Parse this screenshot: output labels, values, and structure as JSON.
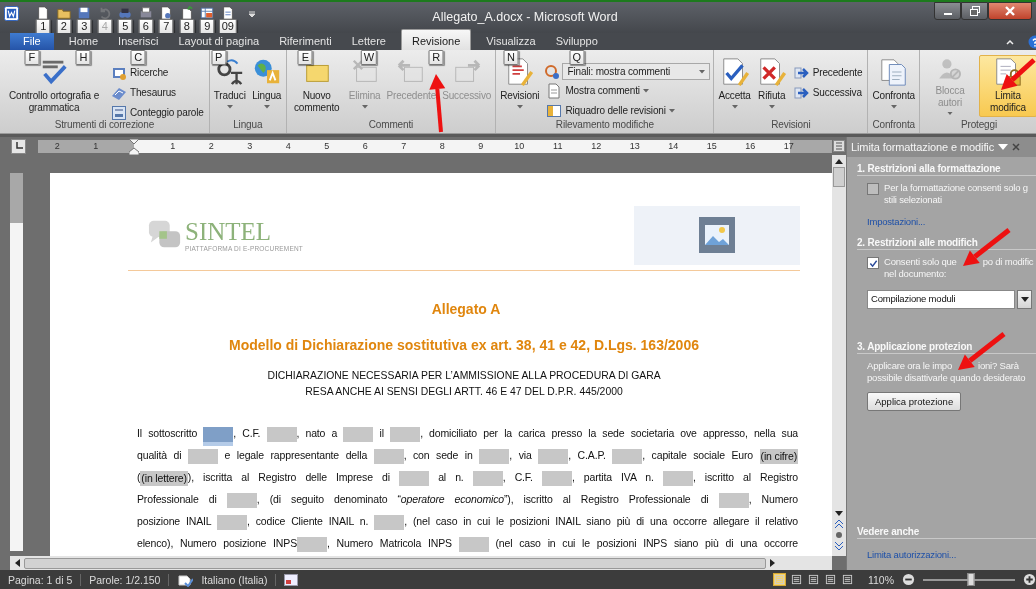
{
  "window": {
    "title": "Allegato_A.docx - Microsoft Word"
  },
  "quick_access": [
    {
      "key": "1",
      "disabled": false
    },
    {
      "key": "2",
      "disabled": false
    },
    {
      "key": "3",
      "disabled": false
    },
    {
      "key": "4",
      "disabled": true
    },
    {
      "key": "5",
      "disabled": false
    },
    {
      "key": "6",
      "disabled": false
    },
    {
      "key": "7",
      "disabled": false
    },
    {
      "key": "8",
      "disabled": false
    },
    {
      "key": "9",
      "disabled": false
    },
    {
      "key": "09",
      "disabled": false
    }
  ],
  "tabs": [
    {
      "label": "File",
      "key": "F",
      "kind": "file",
      "selected": false
    },
    {
      "label": "Home",
      "key": "H",
      "kind": "tab",
      "selected": false
    },
    {
      "label": "Inserisci",
      "key": "C",
      "kind": "tab",
      "selected": false
    },
    {
      "label": "Layout di pagina",
      "key": "P",
      "kind": "tab",
      "selected": false
    },
    {
      "label": "Riferimenti",
      "key": "E",
      "kind": "tab",
      "selected": false
    },
    {
      "label": "Lettere",
      "key": "W",
      "kind": "tab",
      "selected": false
    },
    {
      "label": "Revisione",
      "key": "R",
      "kind": "tab",
      "selected": true
    },
    {
      "label": "Visualizza",
      "key": "N",
      "kind": "tab",
      "selected": false
    },
    {
      "label": "Sviluppo",
      "key": "Q",
      "kind": "tab",
      "selected": false
    }
  ],
  "ribbon": {
    "groups": [
      {
        "label": "Strumenti di correzione",
        "items": [
          {
            "kind": "large",
            "label": "Controllo ortografia e grammatica",
            "dropdown": false,
            "disabled": false,
            "on": false
          },
          {
            "kind": "small",
            "label": "Ricerche",
            "dropdown": false,
            "disabled": false,
            "on": false
          },
          {
            "kind": "small",
            "label": "Thesaurus",
            "dropdown": false,
            "disabled": false,
            "on": false
          },
          {
            "kind": "small",
            "label": "Conteggio parole",
            "dropdown": false,
            "disabled": false,
            "on": false
          }
        ]
      },
      {
        "label": "Lingua",
        "items": [
          {
            "kind": "large",
            "label": "Traduci",
            "dropdown": true,
            "disabled": false,
            "on": false
          },
          {
            "kind": "large",
            "label": "Lingua",
            "dropdown": true,
            "disabled": false,
            "on": false
          }
        ]
      },
      {
        "label": "Commenti",
        "items": [
          {
            "kind": "large",
            "label": "Nuovo commento",
            "dropdown": false,
            "disabled": false,
            "on": false
          },
          {
            "kind": "large",
            "label": "Elimina",
            "dropdown": true,
            "disabled": true,
            "on": false
          },
          {
            "kind": "large",
            "label": "Precedente",
            "dropdown": false,
            "disabled": true,
            "on": false
          },
          {
            "kind": "large",
            "label": "Successivo",
            "dropdown": false,
            "disabled": true,
            "on": false
          }
        ]
      },
      {
        "label": "Rilevamento modifiche",
        "items": [
          {
            "kind": "large",
            "label": "Revisioni",
            "dropdown": true,
            "disabled": false,
            "on": false
          },
          {
            "kind": "combo",
            "label": "Finali: mostra commenti",
            "dropdown": true,
            "disabled": false,
            "on": false
          },
          {
            "kind": "small",
            "label": "Mostra commenti",
            "dropdown": true,
            "disabled": false,
            "on": false
          },
          {
            "kind": "small",
            "label": "Riquadro delle revisioni",
            "dropdown": true,
            "disabled": false,
            "on": false
          }
        ]
      },
      {
        "label": "Revisioni",
        "items": [
          {
            "kind": "large",
            "label": "Accetta",
            "dropdown": true,
            "disabled": false,
            "on": false
          },
          {
            "kind": "large",
            "label": "Rifiuta",
            "dropdown": true,
            "disabled": false,
            "on": false
          },
          {
            "kind": "small",
            "label": "Precedente",
            "dropdown": false,
            "disabled": false,
            "on": false
          },
          {
            "kind": "small",
            "label": "Successiva",
            "dropdown": false,
            "disabled": false,
            "on": false
          }
        ]
      },
      {
        "label": "Confronta",
        "items": [
          {
            "kind": "large",
            "label": "Confronta",
            "dropdown": true,
            "disabled": false,
            "on": false
          }
        ]
      },
      {
        "label": "Proteggi",
        "items": [
          {
            "kind": "large",
            "label": "Blocca autori",
            "dropdown": true,
            "disabled": true,
            "on": false
          },
          {
            "kind": "large",
            "label": "Limita modifica",
            "dropdown": false,
            "disabled": false,
            "on": true
          }
        ]
      }
    ]
  },
  "ruler": {
    "left_labels": [
      "2",
      "1"
    ],
    "right_labels": [
      "1",
      "2",
      "3",
      "4",
      "5",
      "6",
      "7",
      "8",
      "9",
      "10",
      "11",
      "12",
      "13",
      "14",
      "15",
      "16",
      "17"
    ]
  },
  "document": {
    "logo": {
      "name": "SINTEL",
      "tagline": "PIATTAFORMA DI E-PROCUREMENT"
    },
    "title": "Allegato A",
    "subtitle": "Modello di Dichiarazione sostitutiva ex art. 38, 41 e 42, D.Lgs. 163/2006",
    "notice": [
      "DICHIARAZIONE NECESSARIA PER L’AMMISSIONE ALLA PROCEDURA DI GARA",
      "RESA ANCHE AI SENSI DEGLI ARTT. 46 E 47 DEL D.P.R. 445/2000"
    ],
    "paragraph": [
      [
        {
          "kind": "text",
          "text": "Il sottoscritto "
        },
        {
          "kind": "field",
          "selected": true
        },
        {
          "kind": "text",
          "text": ", C.F. "
        },
        {
          "kind": "field",
          "selected": false
        },
        {
          "kind": "text",
          "text": ", nato a "
        },
        {
          "kind": "field",
          "selected": false
        },
        {
          "kind": "text",
          "text": " il "
        },
        {
          "kind": "field",
          "selected": false
        },
        {
          "kind": "text",
          "text": ", domiciliato per la carica presso la sede societaria ove appresso, nella sua"
        }
      ],
      [
        {
          "kind": "text",
          "text": "qualità di "
        },
        {
          "kind": "field",
          "selected": false
        },
        {
          "kind": "text",
          "text": " e legale rappresentante della "
        },
        {
          "kind": "field",
          "selected": false
        },
        {
          "kind": "text",
          "text": ", con sede in "
        },
        {
          "kind": "field",
          "selected": false
        },
        {
          "kind": "text",
          "text": ", via "
        },
        {
          "kind": "field",
          "selected": false
        },
        {
          "kind": "text",
          "text": ", C.A.P. "
        },
        {
          "kind": "field",
          "selected": false
        },
        {
          "kind": "text",
          "text": ", capitale sociale Euro "
        },
        {
          "kind": "field",
          "text": "(in cifre)",
          "selected": false
        }
      ],
      [
        {
          "kind": "text",
          "text": "("
        },
        {
          "kind": "field",
          "text": "(in lettere)",
          "selected": false
        },
        {
          "kind": "text",
          "text": "), iscritta al Registro delle Imprese di "
        },
        {
          "kind": "field",
          "selected": false
        },
        {
          "kind": "text",
          "text": " al n. "
        },
        {
          "kind": "field",
          "selected": false
        },
        {
          "kind": "text",
          "text": ", C.F. "
        },
        {
          "kind": "field",
          "selected": false
        },
        {
          "kind": "text",
          "text": ", partita IVA n. "
        },
        {
          "kind": "field",
          "selected": false
        },
        {
          "kind": "text",
          "text": ", iscritto al Registro"
        }
      ],
      [
        {
          "kind": "text",
          "text": "Professionale di "
        },
        {
          "kind": "field",
          "selected": false
        },
        {
          "kind": "text",
          "text": ", (di seguito denominato “*operatore economico*”), iscritto al Registro Professionale di "
        },
        {
          "kind": "field",
          "selected": false
        },
        {
          "kind": "text",
          "text": ", Numero"
        }
      ],
      [
        {
          "kind": "text",
          "text": "posizione INAIL "
        },
        {
          "kind": "field",
          "selected": false
        },
        {
          "kind": "text",
          "text": ", codice Cliente INAIL n. "
        },
        {
          "kind": "field",
          "selected": false
        },
        {
          "kind": "text",
          "text": ", (nel caso in cui le posizioni INAIL siano più di una occorre allegare il relativo"
        }
      ],
      [
        {
          "kind": "text",
          "text": "elenco), Numero posizione INPS"
        },
        {
          "kind": "field",
          "selected": false
        },
        {
          "kind": "text",
          "text": ", Numero Matricola INPS "
        },
        {
          "kind": "field",
          "selected": false
        },
        {
          "kind": "text",
          "text": " (nel caso in cui le posizioni INPS siano più di una occorre"
        }
      ]
    ]
  },
  "task_pane": {
    "title": "Limita formattazione e modific",
    "sections": [
      {
        "heading": "1. Restrizioni alla formattazione",
        "checkbox": {
          "label": "Per la formattazione consenti solo g",
          "label_2": "stili selezionati",
          "checked": false
        },
        "link": "Impostazioni..."
      },
      {
        "heading": "2. Restrizioni alle modifich",
        "checkbox": {
          "label": "Consenti solo que",
          "label_cont": "po di modific",
          "label_2": "nel documento:",
          "checked": true
        },
        "dropdown": "Compilazione moduli"
      },
      {
        "heading": "3. Applicazione protezion",
        "text": "Applicare ora le impo",
        "text_cont": "ioni? Sarà",
        "text_2": "possibile disattivarle quando desiderato",
        "button": "Applica protezione"
      }
    ],
    "see_also": {
      "heading": "Vedere anche",
      "link": "Limita autorizzazioni..."
    }
  },
  "status_bar": {
    "page": "Pagina: 1 di 5",
    "words": "Parole: 1/2.150",
    "language": "Italiano (Italia)",
    "zoom": "110%",
    "zoom_level": {
      "level": 0.52
    },
    "views": [
      {
        "selected": true
      },
      {
        "selected": false
      },
      {
        "selected": false
      },
      {
        "selected": false
      },
      {
        "selected": false
      }
    ]
  }
}
